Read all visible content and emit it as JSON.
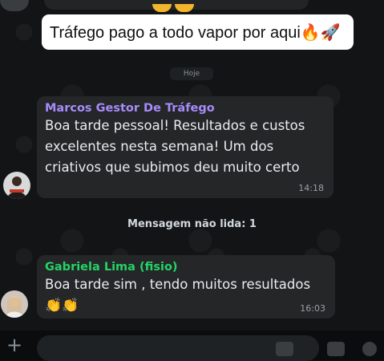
{
  "banner": {
    "text": "Tráfego pago a todo vapor por aqui🔥🚀"
  },
  "date_chip": {
    "label": "Hoje"
  },
  "messages": [
    {
      "sender": "Marcos Gestor De Tráfego",
      "sender_color": "#a78bfa",
      "lines": [
        "Boa tarde pessoal! Resultados e custos",
        "excelentes nesta semana!  Um dos",
        "criativos que subimos deu muito certo"
      ],
      "time": "14:18"
    },
    {
      "sender": "Gabriela Lima (fisio)",
      "sender_color": "#25d366",
      "lines": [
        "Boa tarde sim , tendo muitos resultados",
        "👏👏"
      ],
      "time": "16:03"
    }
  ],
  "unread_divider": {
    "label": "Mensagem não lida: 1"
  },
  "composer": {
    "attach_icon": "plus-icon"
  }
}
